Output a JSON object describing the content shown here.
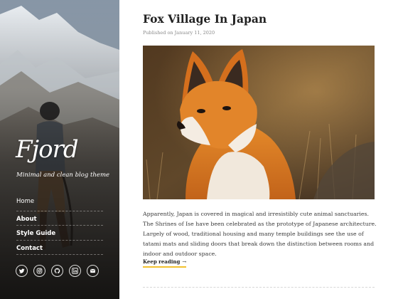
{
  "sidebar": {
    "logo": "Fjord",
    "tagline": "Minimal and clean blog theme",
    "nav": [
      {
        "label": "Home",
        "active": true
      },
      {
        "label": "About",
        "active": false
      },
      {
        "label": "Style Guide",
        "active": false
      },
      {
        "label": "Contact",
        "active": false
      }
    ],
    "social": [
      {
        "icon": "twitter-icon"
      },
      {
        "icon": "instagram-icon"
      },
      {
        "icon": "github-icon"
      },
      {
        "icon": "linkedin-icon"
      },
      {
        "icon": "email-icon"
      }
    ]
  },
  "post": {
    "title": "Fox Village In Japan",
    "meta": "Published on January 11, 2020",
    "excerpt": "Apparently, Japan is covered in magical and irresistibly cute animal sanctuaries. The Shrines of Ise have been celebrated as the prototype of Japanese architecture. Largely of wood, traditional housing and many temple buildings see the use of tatami mats and sliding doors that break down the distinction between rooms and indoor and outdoor space.",
    "read_more": "Keep reading",
    "read_more_arrow": "→"
  },
  "colors": {
    "accent": "#f2c12e",
    "title": "#222222",
    "meta": "#8a8a8a"
  }
}
